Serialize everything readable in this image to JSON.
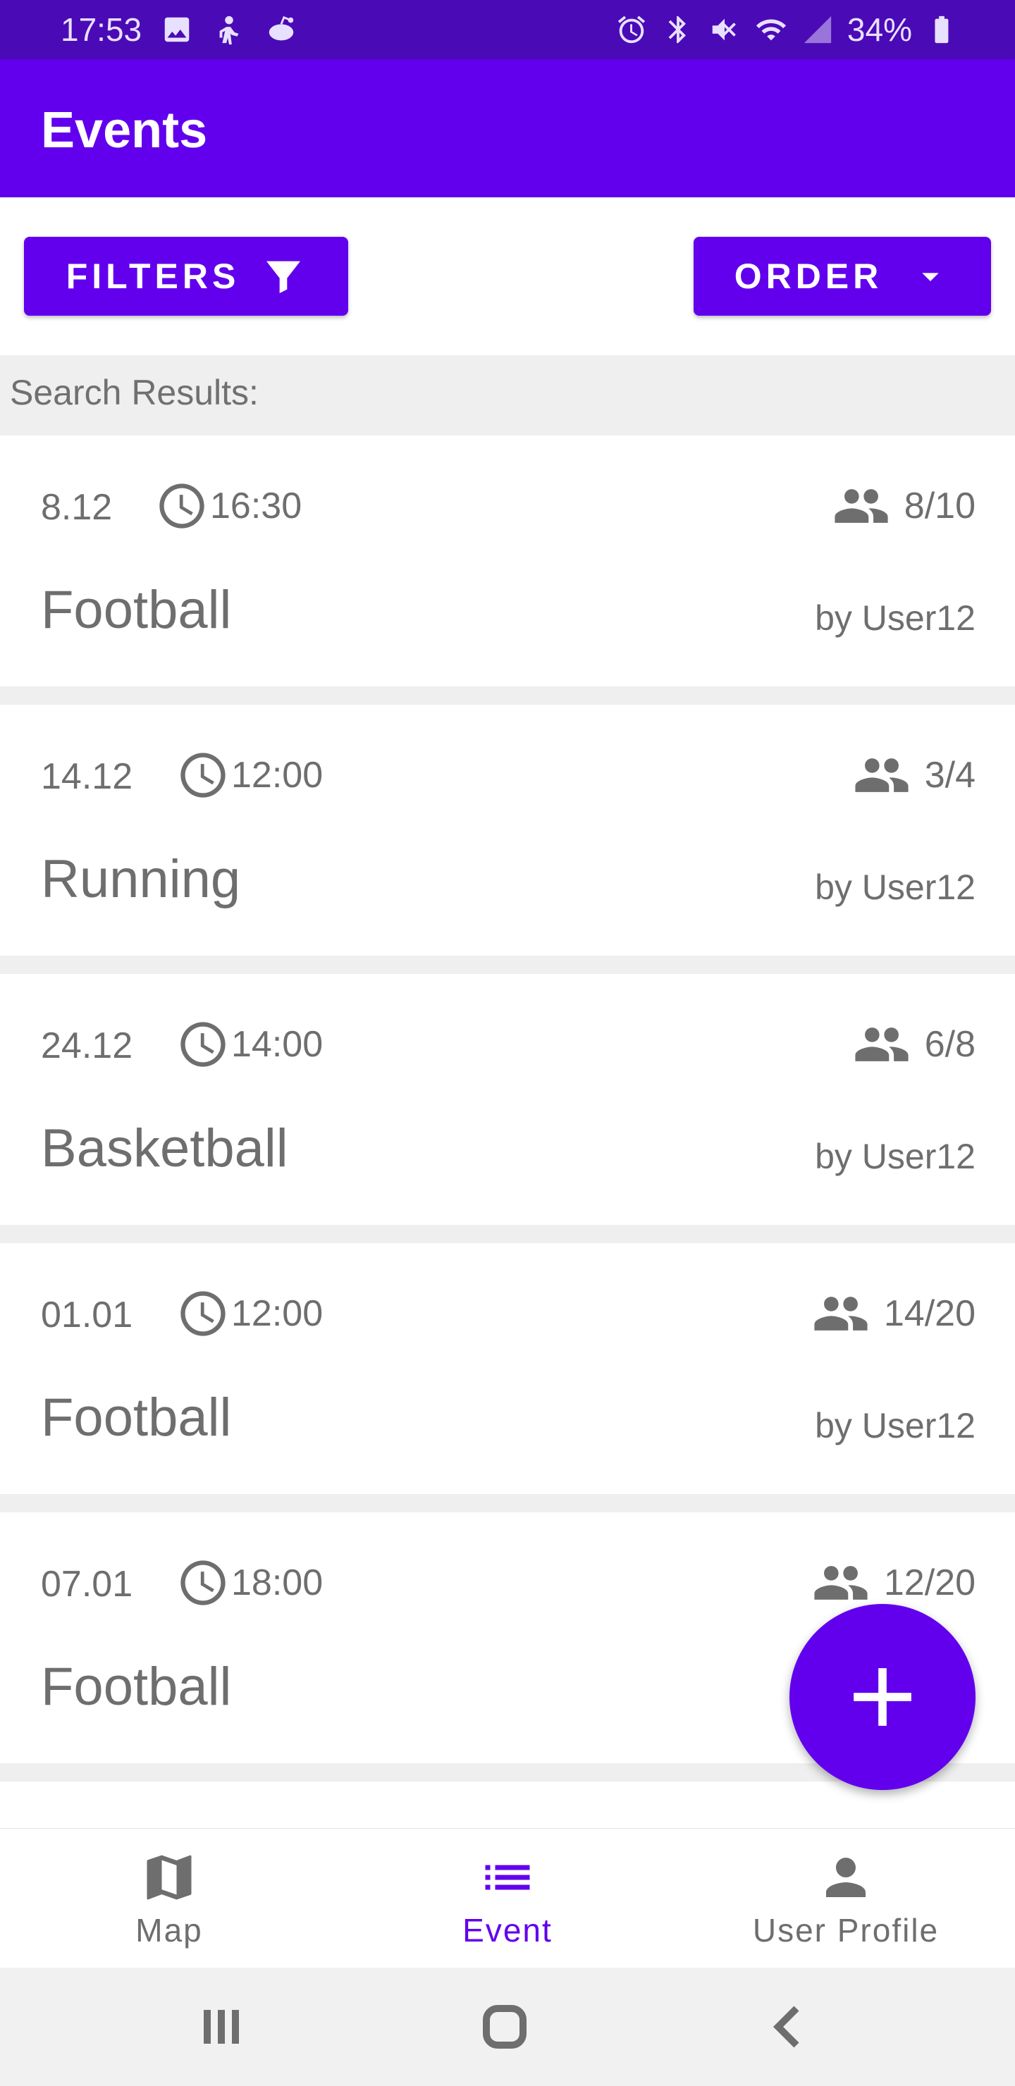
{
  "status_bar": {
    "time": "17:53",
    "battery": "34%",
    "left_icons": [
      "image-icon",
      "person-icon",
      "reddit-icon"
    ],
    "right_icons": [
      "alarm-icon",
      "bluetooth-icon",
      "mute-icon",
      "wifi-icon",
      "signal-icon",
      "battery-icon"
    ]
  },
  "app_bar": {
    "title": "Events"
  },
  "toolbar": {
    "filters_label": "FILTERS",
    "filters_icon": "filter-icon",
    "order_label": "ORDER",
    "order_icon": "dropdown-arrow-icon"
  },
  "results": {
    "label": "Search Results:"
  },
  "events": [
    {
      "date": "8.12",
      "time": "16:30",
      "participants": "8/10",
      "title": "Football",
      "organizer": "by User12"
    },
    {
      "date": "14.12",
      "time": "12:00",
      "participants": "3/4",
      "title": "Running",
      "organizer": "by User12"
    },
    {
      "date": "24.12",
      "time": "14:00",
      "participants": "6/8",
      "title": "Basketball",
      "organizer": "by User12"
    },
    {
      "date": "01.01",
      "time": "12:00",
      "participants": "14/20",
      "title": "Football",
      "organizer": "by User12"
    },
    {
      "date": "07.01",
      "time": "18:00",
      "participants": "12/20",
      "title": "Football",
      "organizer": ""
    }
  ],
  "fab": {
    "icon": "plus-icon"
  },
  "bottom_nav": {
    "items": [
      {
        "label": "Map",
        "icon": "map-icon",
        "active": false
      },
      {
        "label": "Event",
        "icon": "list-icon",
        "active": true
      },
      {
        "label": "User Profile",
        "icon": "person-icon",
        "active": false
      }
    ]
  },
  "colors": {
    "primary": "#6200ee",
    "status_bar": "#4a0ab6",
    "text": "#6e6e6e",
    "divider": "#efefef"
  }
}
